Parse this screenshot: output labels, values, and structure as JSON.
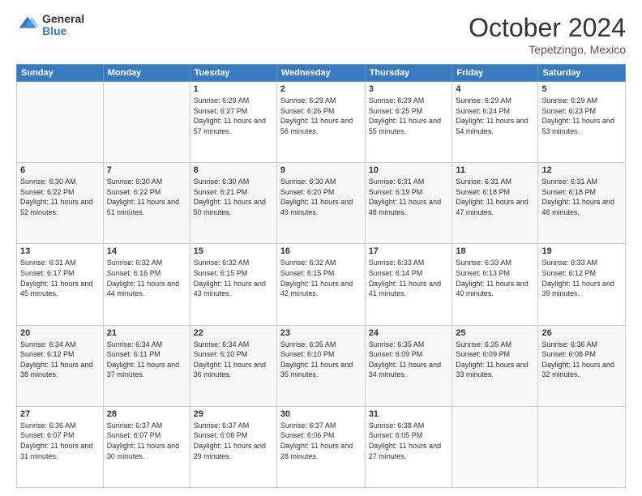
{
  "logo": {
    "general": "General",
    "blue": "Blue"
  },
  "header": {
    "month": "October 2024",
    "location": "Tepetzingo, Mexico"
  },
  "days_of_week": [
    "Sunday",
    "Monday",
    "Tuesday",
    "Wednesday",
    "Thursday",
    "Friday",
    "Saturday"
  ],
  "weeks": [
    [
      {
        "day": "",
        "sunrise": "",
        "sunset": "",
        "daylight": ""
      },
      {
        "day": "",
        "sunrise": "",
        "sunset": "",
        "daylight": ""
      },
      {
        "day": "1",
        "sunrise": "Sunrise: 6:29 AM",
        "sunset": "Sunset: 6:27 PM",
        "daylight": "Daylight: 11 hours and 57 minutes."
      },
      {
        "day": "2",
        "sunrise": "Sunrise: 6:29 AM",
        "sunset": "Sunset: 6:26 PM",
        "daylight": "Daylight: 11 hours and 56 minutes."
      },
      {
        "day": "3",
        "sunrise": "Sunrise: 6:29 AM",
        "sunset": "Sunset: 6:25 PM",
        "daylight": "Daylight: 11 hours and 55 minutes."
      },
      {
        "day": "4",
        "sunrise": "Sunrise: 6:29 AM",
        "sunset": "Sunset: 6:24 PM",
        "daylight": "Daylight: 11 hours and 54 minutes."
      },
      {
        "day": "5",
        "sunrise": "Sunrise: 6:29 AM",
        "sunset": "Sunset: 6:23 PM",
        "daylight": "Daylight: 11 hours and 53 minutes."
      }
    ],
    [
      {
        "day": "6",
        "sunrise": "Sunrise: 6:30 AM",
        "sunset": "Sunset: 6:22 PM",
        "daylight": "Daylight: 11 hours and 52 minutes."
      },
      {
        "day": "7",
        "sunrise": "Sunrise: 6:30 AM",
        "sunset": "Sunset: 6:22 PM",
        "daylight": "Daylight: 11 hours and 51 minutes."
      },
      {
        "day": "8",
        "sunrise": "Sunrise: 6:30 AM",
        "sunset": "Sunset: 6:21 PM",
        "daylight": "Daylight: 11 hours and 50 minutes."
      },
      {
        "day": "9",
        "sunrise": "Sunrise: 6:30 AM",
        "sunset": "Sunset: 6:20 PM",
        "daylight": "Daylight: 11 hours and 49 minutes."
      },
      {
        "day": "10",
        "sunrise": "Sunrise: 6:31 AM",
        "sunset": "Sunset: 6:19 PM",
        "daylight": "Daylight: 11 hours and 48 minutes."
      },
      {
        "day": "11",
        "sunrise": "Sunrise: 6:31 AM",
        "sunset": "Sunset: 6:18 PM",
        "daylight": "Daylight: 11 hours and 47 minutes."
      },
      {
        "day": "12",
        "sunrise": "Sunrise: 6:31 AM",
        "sunset": "Sunset: 6:18 PM",
        "daylight": "Daylight: 11 hours and 46 minutes."
      }
    ],
    [
      {
        "day": "13",
        "sunrise": "Sunrise: 6:31 AM",
        "sunset": "Sunset: 6:17 PM",
        "daylight": "Daylight: 11 hours and 45 minutes."
      },
      {
        "day": "14",
        "sunrise": "Sunrise: 6:32 AM",
        "sunset": "Sunset: 6:16 PM",
        "daylight": "Daylight: 11 hours and 44 minutes."
      },
      {
        "day": "15",
        "sunrise": "Sunrise: 6:32 AM",
        "sunset": "Sunset: 6:15 PM",
        "daylight": "Daylight: 11 hours and 43 minutes."
      },
      {
        "day": "16",
        "sunrise": "Sunrise: 6:32 AM",
        "sunset": "Sunset: 6:15 PM",
        "daylight": "Daylight: 11 hours and 42 minutes."
      },
      {
        "day": "17",
        "sunrise": "Sunrise: 6:33 AM",
        "sunset": "Sunset: 6:14 PM",
        "daylight": "Daylight: 11 hours and 41 minutes."
      },
      {
        "day": "18",
        "sunrise": "Sunrise: 6:33 AM",
        "sunset": "Sunset: 6:13 PM",
        "daylight": "Daylight: 11 hours and 40 minutes."
      },
      {
        "day": "19",
        "sunrise": "Sunrise: 6:33 AM",
        "sunset": "Sunset: 6:12 PM",
        "daylight": "Daylight: 11 hours and 39 minutes."
      }
    ],
    [
      {
        "day": "20",
        "sunrise": "Sunrise: 6:34 AM",
        "sunset": "Sunset: 6:12 PM",
        "daylight": "Daylight: 11 hours and 38 minutes."
      },
      {
        "day": "21",
        "sunrise": "Sunrise: 6:34 AM",
        "sunset": "Sunset: 6:11 PM",
        "daylight": "Daylight: 11 hours and 37 minutes."
      },
      {
        "day": "22",
        "sunrise": "Sunrise: 6:34 AM",
        "sunset": "Sunset: 6:10 PM",
        "daylight": "Daylight: 11 hours and 36 minutes."
      },
      {
        "day": "23",
        "sunrise": "Sunrise: 6:35 AM",
        "sunset": "Sunset: 6:10 PM",
        "daylight": "Daylight: 11 hours and 35 minutes."
      },
      {
        "day": "24",
        "sunrise": "Sunrise: 6:35 AM",
        "sunset": "Sunset: 6:09 PM",
        "daylight": "Daylight: 11 hours and 34 minutes."
      },
      {
        "day": "25",
        "sunrise": "Sunrise: 6:35 AM",
        "sunset": "Sunset: 6:09 PM",
        "daylight": "Daylight: 11 hours and 33 minutes."
      },
      {
        "day": "26",
        "sunrise": "Sunrise: 6:36 AM",
        "sunset": "Sunset: 6:08 PM",
        "daylight": "Daylight: 11 hours and 32 minutes."
      }
    ],
    [
      {
        "day": "27",
        "sunrise": "Sunrise: 6:36 AM",
        "sunset": "Sunset: 6:07 PM",
        "daylight": "Daylight: 11 hours and 31 minutes."
      },
      {
        "day": "28",
        "sunrise": "Sunrise: 6:37 AM",
        "sunset": "Sunset: 6:07 PM",
        "daylight": "Daylight: 11 hours and 30 minutes."
      },
      {
        "day": "29",
        "sunrise": "Sunrise: 6:37 AM",
        "sunset": "Sunset: 6:06 PM",
        "daylight": "Daylight: 11 hours and 29 minutes."
      },
      {
        "day": "30",
        "sunrise": "Sunrise: 6:37 AM",
        "sunset": "Sunset: 6:06 PM",
        "daylight": "Daylight: 11 hours and 28 minutes."
      },
      {
        "day": "31",
        "sunrise": "Sunrise: 6:38 AM",
        "sunset": "Sunset: 6:05 PM",
        "daylight": "Daylight: 11 hours and 27 minutes."
      },
      {
        "day": "",
        "sunrise": "",
        "sunset": "",
        "daylight": ""
      },
      {
        "day": "",
        "sunrise": "",
        "sunset": "",
        "daylight": ""
      }
    ]
  ]
}
